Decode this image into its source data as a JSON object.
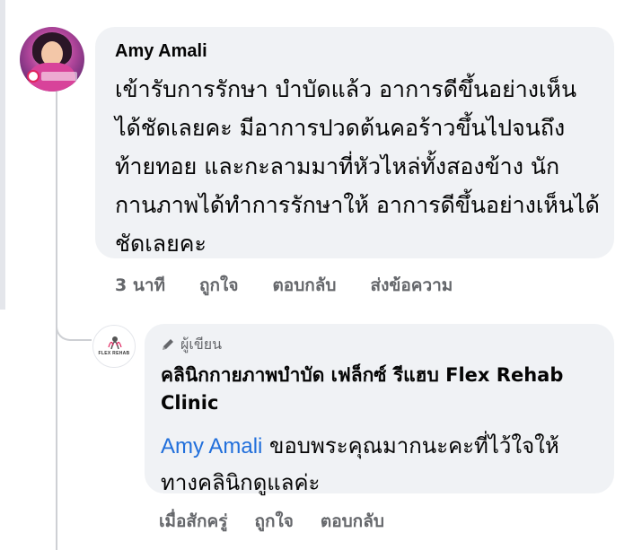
{
  "comment": {
    "author": "Amy Amali",
    "text": "เข้ารับการรักษา บำบัดแล้ว อาการดีขึ้นอย่างเห็นได้ชัดเลยคะ มีอาการปวดต้นคอร้าวขึ้นไปจนถึงท้ายทอย และกะลามมาที่หัวไหล่ทั้งสองข้าง นักกานภาพได้ทำการรักษาให้ อาการดีขึ้นอย่างเห็นได้ชัดเลยคะ",
    "time": "3 นาที",
    "actions": {
      "like": "ถูกใจ",
      "reply": "ตอบกลับ",
      "send": "ส่งข้อความ"
    }
  },
  "reply": {
    "author_badge": "ผู้เขียน",
    "page_name": "คลินิกกายภาพบำบัด เฟล็กซ์ รีแฮบ Flex Rehab Clinic",
    "avatar_logo_text": "FLEX REHAB",
    "mention": "Amy Amali",
    "text": " ขอบพระคุณมากนะคะที่ไว้ใจให้ทางคลินิกดูแลค่ะ",
    "time": "เมื่อสักครู่",
    "actions": {
      "like": "ถูกใจ",
      "reply": "ตอบกลับ"
    }
  },
  "icons": {
    "author_badge_icon": "pencil-icon"
  },
  "colors": {
    "bubble": "#f0f2f5",
    "mention": "#216fdb",
    "meta_text": "#65676b"
  }
}
